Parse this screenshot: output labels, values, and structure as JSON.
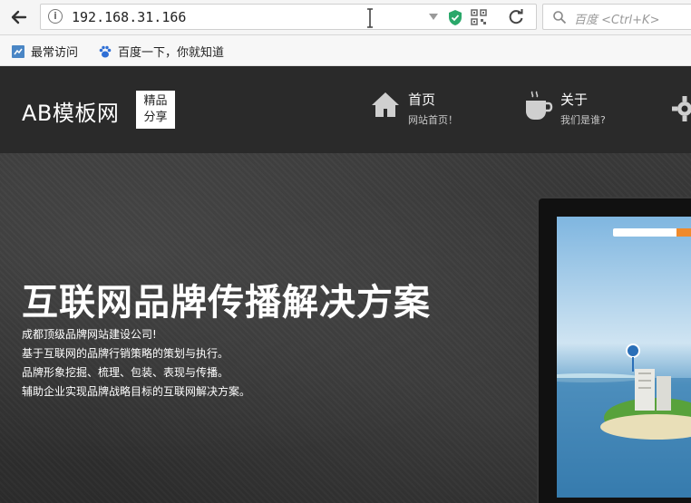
{
  "browser": {
    "url": "192.168.31.166",
    "search_placeholder": "百度 <Ctrl+K>",
    "bookmarks": [
      {
        "label": "最常访问",
        "icon": "bookmark-page-icon"
      },
      {
        "label": "百度一下，你就知道",
        "icon": "baidu-paw-icon"
      }
    ]
  },
  "site": {
    "logo": "AB模板网",
    "badge": [
      "精品",
      "分享"
    ],
    "nav": [
      {
        "title": "首页",
        "subtitle": "网站首页！",
        "icon": "home-icon"
      },
      {
        "title": "关于",
        "subtitle": "我们是谁?",
        "icon": "coffee-cup-icon"
      }
    ],
    "hero": {
      "headline": "互联网品牌传播解决方案",
      "lines": [
        "成都顶级品牌网站建设公司!",
        "基于互联网的品牌行销策略的策划与执行。",
        "品牌形象挖掘、梳理、包装、表现与传播。",
        "辅助企业实现品牌战略目标的互联网解决方案。"
      ]
    }
  },
  "colors": {
    "dark_bg": "#2a2a2a",
    "accent_orange": "#f08a2c",
    "shield_green": "#2aa86a"
  }
}
